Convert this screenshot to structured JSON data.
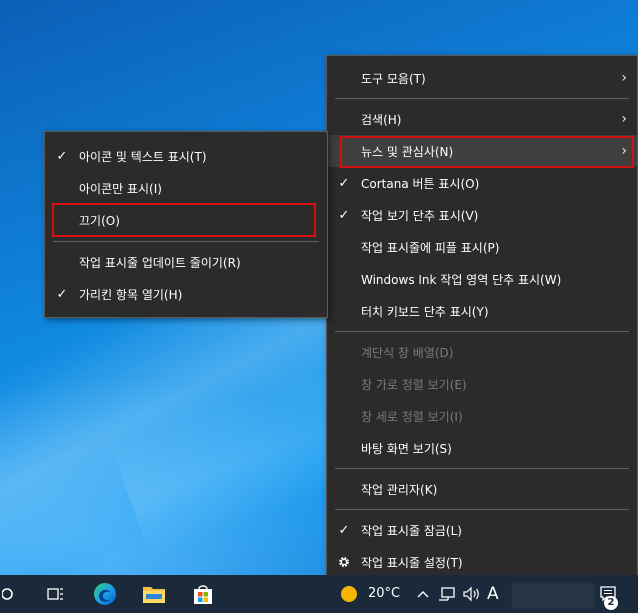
{
  "main_menu": {
    "items": [
      {
        "label": "도구 모음(T)",
        "submenu": true
      },
      {
        "label": "검색(H)",
        "submenu": true
      },
      {
        "label": "뉴스 및 관심사(N)",
        "submenu": true
      },
      {
        "label": "Cortana 버튼 표시(O)",
        "checked": true
      },
      {
        "label": "작업 보기 단추 표시(V)",
        "checked": true
      },
      {
        "label": "작업 표시줄에 피플 표시(P)"
      },
      {
        "label": "Windows Ink 작업 영역 단추 표시(W)"
      },
      {
        "label": "터치 키보드 단추 표시(Y)"
      },
      {
        "label": "계단식 창 배열(D)",
        "disabled": true
      },
      {
        "label": "창 가로 정렬 보기(E)",
        "disabled": true
      },
      {
        "label": "창 세로 정렬 보기(I)",
        "disabled": true
      },
      {
        "label": "바탕 화면 보기(S)"
      },
      {
        "label": "작업 관리자(K)"
      },
      {
        "label": "작업 표시줄 잠금(L)",
        "checked": true
      },
      {
        "label": "작업 표시줄 설정(T)",
        "icon": "gear-icon"
      }
    ]
  },
  "sub_menu": {
    "items": [
      {
        "label": "아이콘 및 텍스트 표시(T)",
        "checked": true
      },
      {
        "label": "아이콘만 표시(I)"
      },
      {
        "label": "끄기(O)"
      },
      {
        "label": "작업 표시줄 업데이트 줄이기(R)"
      },
      {
        "label": "가리킨 항목 열기(H)",
        "checked": true
      }
    ]
  },
  "check_glyph": "✓",
  "arrow_glyph": "›",
  "taskbar": {
    "icons": [
      "search-circle-icon",
      "task-view-icon",
      "edge-icon",
      "file-explorer-icon",
      "store-icon"
    ],
    "weather_temp": "20°C",
    "ime_letter": "A",
    "notification_count": "2"
  },
  "colors": {
    "menu_bg": "#2b2b2b",
    "highlight_box": "#d30f10",
    "taskbar_bg": "#1b2a3a"
  }
}
